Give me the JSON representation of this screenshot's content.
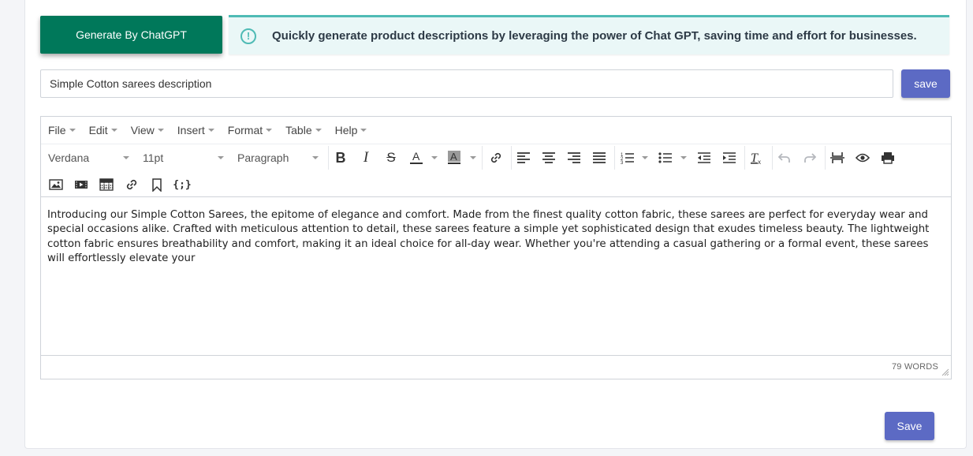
{
  "generate_button": "Generate By ChatGPT",
  "info_banner": {
    "icon": "exclamation-circle-icon",
    "text": "Quickly generate product descriptions by leveraging the power of Chat GPT, saving time and effort for businesses."
  },
  "description_input": {
    "value": "Simple Cotton sarees description"
  },
  "save_small_label": "save",
  "editor": {
    "menus": [
      "File",
      "Edit",
      "View",
      "Insert",
      "Format",
      "Table",
      "Help"
    ],
    "font_family": "Verdana",
    "font_size": "11pt",
    "block_format": "Paragraph",
    "content": "Introducing our Simple Cotton Sarees, the epitome of elegance and comfort. Made from the finest quality cotton fabric, these sarees are perfect for everyday wear and special occasions alike. Crafted with meticulous attention to detail, these sarees feature a simple yet sophisticated design that exudes timeless beauty. The lightweight cotton fabric ensures breathability and comfort, making it an ideal choice for all-day wear. Whether you're attending a casual gathering or a formal event, these sarees will effortlessly elevate your",
    "word_count": "79 WORDS"
  },
  "save_big_label": "Save",
  "colors": {
    "generate": "#00785a",
    "accent": "#5c6ac4",
    "info_border": "#4fbbb5",
    "info_bg": "#eaf7f7"
  }
}
